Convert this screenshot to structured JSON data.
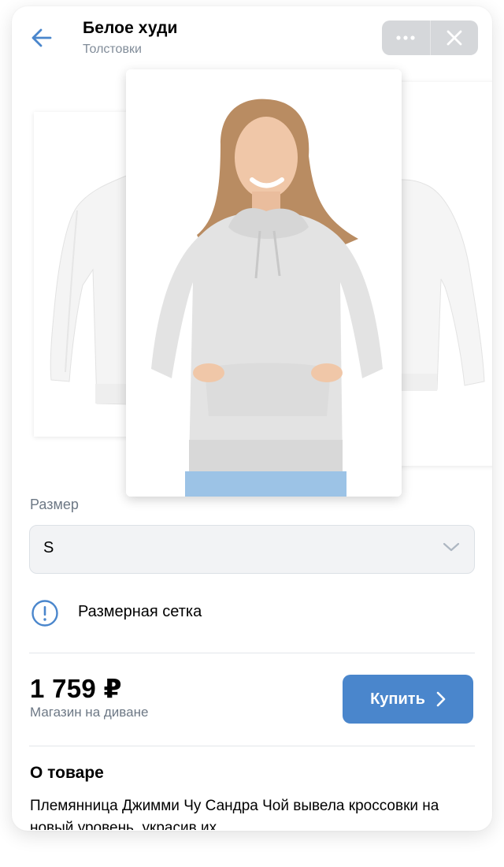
{
  "header": {
    "title": "Белое худи",
    "subtitle": "Толстовки",
    "back_icon": "arrow-left-icon",
    "more_icon": "more-horizontal-icon",
    "close_icon": "close-icon"
  },
  "gallery": {
    "images": [
      "white-hoodie-flat",
      "woman-grey-hoodie",
      "white-hoodie-back"
    ]
  },
  "size": {
    "label": "Размер",
    "selected": "S",
    "chart_link": "Размерная сетка"
  },
  "purchase": {
    "price": "1 759 ₽",
    "store": "Магазин на диване",
    "buy_label": "Купить"
  },
  "about": {
    "title": "О товаре",
    "text": "Племянница Джимми Чу Сандра Чой вывела кроссовки на новый уровень, украсив их"
  },
  "colors": {
    "accent": "#4a86cc",
    "secondary_text": "#818c99"
  }
}
